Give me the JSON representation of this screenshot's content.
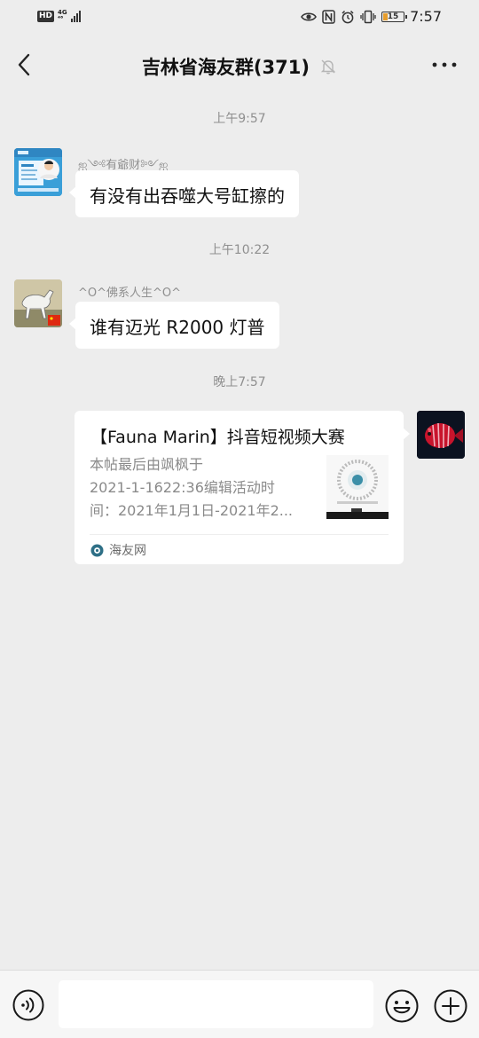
{
  "status_bar": {
    "hd": "HD",
    "network": [
      "4G",
      "⁴⁶"
    ],
    "battery_pct": "15",
    "time": "7:57",
    "icons": [
      "eye-icon",
      "nfc-icon",
      "alarm-icon",
      "vibrate-icon",
      "battery-icon"
    ]
  },
  "header": {
    "title": "吉林省海友群(371)",
    "muted": true
  },
  "messages": [
    {
      "time": "上午9:57",
      "sender": "ஐ༺有爺财༻ஐ",
      "text": "有没有出吞噬大号缸擦的"
    },
    {
      "time": "上午10:22",
      "sender": "^O^佛系人生^O^",
      "text": "谁有迈光 R2000 灯普"
    },
    {
      "time": "晚上7:57",
      "card": {
        "title": "【Fauna Marin】抖音短视频大赛",
        "desc_lines": [
          "本帖最后由飒枫于",
          "2021-1-1622:36编辑活动时",
          "间：2021年1月1日-2021年2..."
        ],
        "source": "海友网"
      }
    }
  ],
  "input": {
    "placeholder": ""
  },
  "colors": {
    "background": "#ededed",
    "bubble": "#ffffff",
    "timestamp": "#8f8f8f"
  }
}
